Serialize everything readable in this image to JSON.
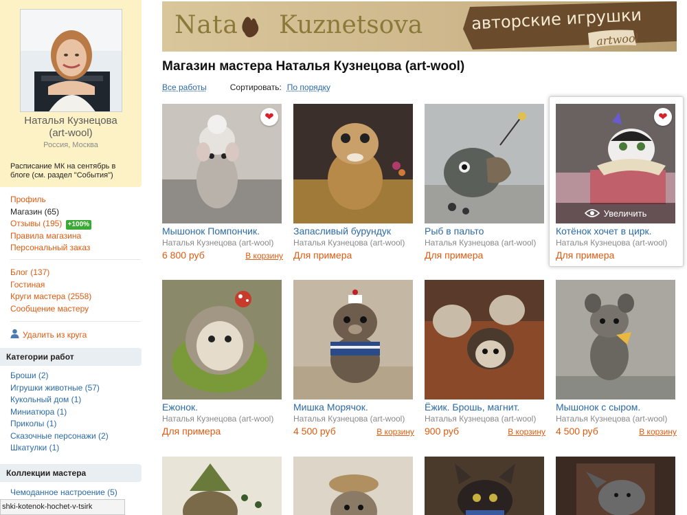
{
  "profile": {
    "name_line1": "Наталья Кузнецова",
    "name_line2": "(art-wool)",
    "location": "Россия, Москва",
    "note": "Расписание МК на сентябрь в блоге (см. раздел \"События\")"
  },
  "nav": {
    "profile": "Профиль",
    "shop": "Магазин (65)",
    "reviews": "Отзывы (195)",
    "reviews_badge": "+100%",
    "rules": "Правила магазина",
    "custom_order": "Персональный заказ",
    "blog": "Блог (137)",
    "guestroom": "Гостиная",
    "circles": "Круги мастера (2558)",
    "message": "Сообщение мастеру",
    "unfollow": "Удалить из круга"
  },
  "categories": {
    "heading": "Категории работ",
    "items": [
      "Броши (2)",
      "Игрушки животные (57)",
      "Кукольный дом (1)",
      "Миниатюра (1)",
      "Приколы (1)",
      "Сказочные персонажи (2)",
      "Шкатулки (1)"
    ]
  },
  "collections": {
    "heading": "Коллекции мастера",
    "items": [
      "Чемоданное настроение (5)"
    ]
  },
  "status_bar": "shki-kotenok-hochet-v-tsirk",
  "banner": {
    "logo_left": "Nata",
    "logo_right": "Kuznetsova",
    "tagline": "авторские игрушки",
    "brand": "artwool"
  },
  "page_title": "Магазин мастера Наталья Кузнецова (art-wool)",
  "toolbar": {
    "all_works": "Все работы",
    "sort_label": "Сортировать:",
    "sort_value": "По порядку"
  },
  "products": [
    {
      "title": "Мышонок Помпончик.",
      "author": "Наталья Кузнецова (art-wool)",
      "price": "6 800 руб",
      "cart": "В корзину",
      "heart": "true"
    },
    {
      "title": "Запасливый бурундук",
      "author": "Наталья Кузнецова (art-wool)",
      "price": "Для примера",
      "cart": ""
    },
    {
      "title": "Рыб в пальто",
      "author": "Наталья Кузнецова (art-wool)",
      "price": "Для примера",
      "cart": ""
    },
    {
      "title": "Котёнок хочет в цирк.",
      "author": "Наталья Кузнецова (art-wool)",
      "price": "Для примера",
      "cart": "",
      "heart": "true",
      "zoom": "Увеличить"
    },
    {
      "title": "Ежонок.",
      "author": "Наталья Кузнецова (art-wool)",
      "price": "Для примера",
      "cart": ""
    },
    {
      "title": "Мишка Морячок.",
      "author": "Наталья Кузнецова (art-wool)",
      "price": "4 500 руб",
      "cart": "В корзину"
    },
    {
      "title": "Ёжик. Брошь, магнит.",
      "author": "Наталья Кузнецова (art-wool)",
      "price": "900 руб",
      "cart": "В корзину"
    },
    {
      "title": "Мышонок с сыром.",
      "author": "Наталья Кузнецова (art-wool)",
      "price": "4 500 руб",
      "cart": "В корзину"
    }
  ],
  "colors": {
    "link_orange": "#e05a10",
    "link_blue": "#2b6aa8",
    "profile_bg": "#fdf2c6",
    "badge_green": "#3aaa35",
    "heart_red": "#d8202b"
  }
}
